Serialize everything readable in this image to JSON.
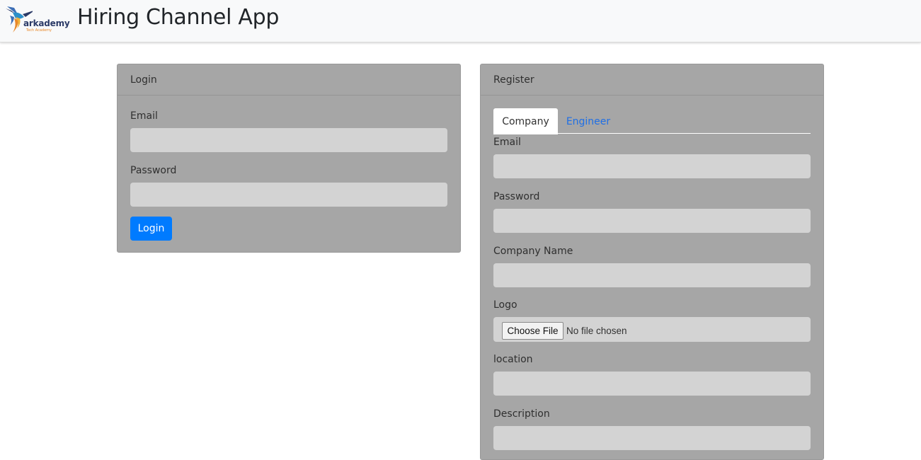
{
  "header": {
    "brand_name": "arkademy",
    "brand_sub": "Tech Academy",
    "title": "Hiring Channel App"
  },
  "login": {
    "header": "Login",
    "email_label": "Email",
    "email_value": "",
    "password_label": "Password",
    "password_value": "",
    "submit_label": "Login"
  },
  "register": {
    "header": "Register",
    "tabs": [
      {
        "label": "Company",
        "active": true
      },
      {
        "label": "Engineer",
        "active": false
      }
    ],
    "email_label": "Email",
    "password_label": "Password",
    "company_name_label": "Company Name",
    "logo_label": "Logo",
    "file_button_label": "Choose File",
    "file_status": "No file chosen",
    "location_label": "location",
    "description_label": "Description"
  },
  "colors": {
    "card_background": "#a6a6a6",
    "input_background": "#d3d3d3",
    "primary": "#007bff",
    "link": "#1f6fe5",
    "navbar": "#f8f9fa"
  }
}
